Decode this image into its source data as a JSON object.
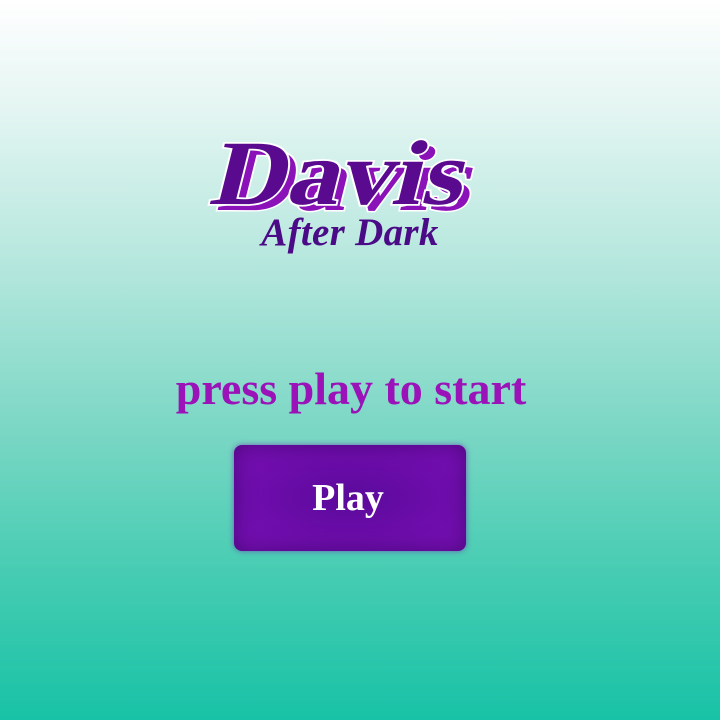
{
  "logo": {
    "title": "Davis",
    "subtitle": "After Dark",
    "colors": {
      "title_fill": "#5a0a8e",
      "title_shadow": "#8b12b8",
      "title_outline": "#ffffff",
      "subtitle": "#4b0a86"
    }
  },
  "prompt": {
    "text": "press play to start",
    "color": "#9a12b8"
  },
  "play_button": {
    "label": "Play",
    "color": "#6a0ca8"
  },
  "background": {
    "top_color": "#ffffff",
    "bottom_color": "#18c2a6"
  }
}
